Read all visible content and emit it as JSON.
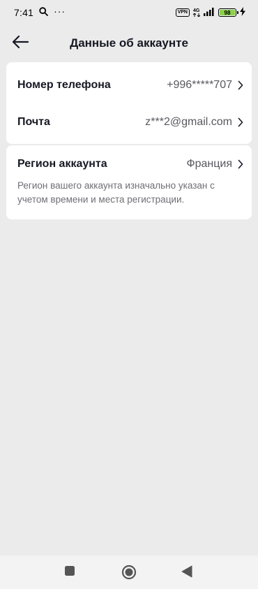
{
  "status_bar": {
    "time": "7:41",
    "more": "···",
    "vpn": "VPN",
    "network": "4G",
    "battery": "98",
    "battery_level_percent": 98
  },
  "header": {
    "title": "Данные об аккаунте"
  },
  "contact": {
    "phone_label": "Номер телефона",
    "phone_value": "+996*****707",
    "email_label": "Почта",
    "email_value": "z***2@gmail.com"
  },
  "region": {
    "label": "Регион аккаунта",
    "value": "Франция",
    "description": "Регион вашего аккаунта изначально указан с учетом времени и места регистрации."
  },
  "icons": {
    "back": "arrow-left-icon",
    "chevron": "chevron-right-icon",
    "search": "search-icon",
    "signal": "signal-icon",
    "charging": "charging-bolt-icon",
    "nav_recents": "square-icon",
    "nav_home": "circle-icon",
    "nav_back": "triangle-back-icon"
  },
  "colors": {
    "battery": "#8bd14a",
    "background": "#ebebeb",
    "card": "#ffffff"
  }
}
